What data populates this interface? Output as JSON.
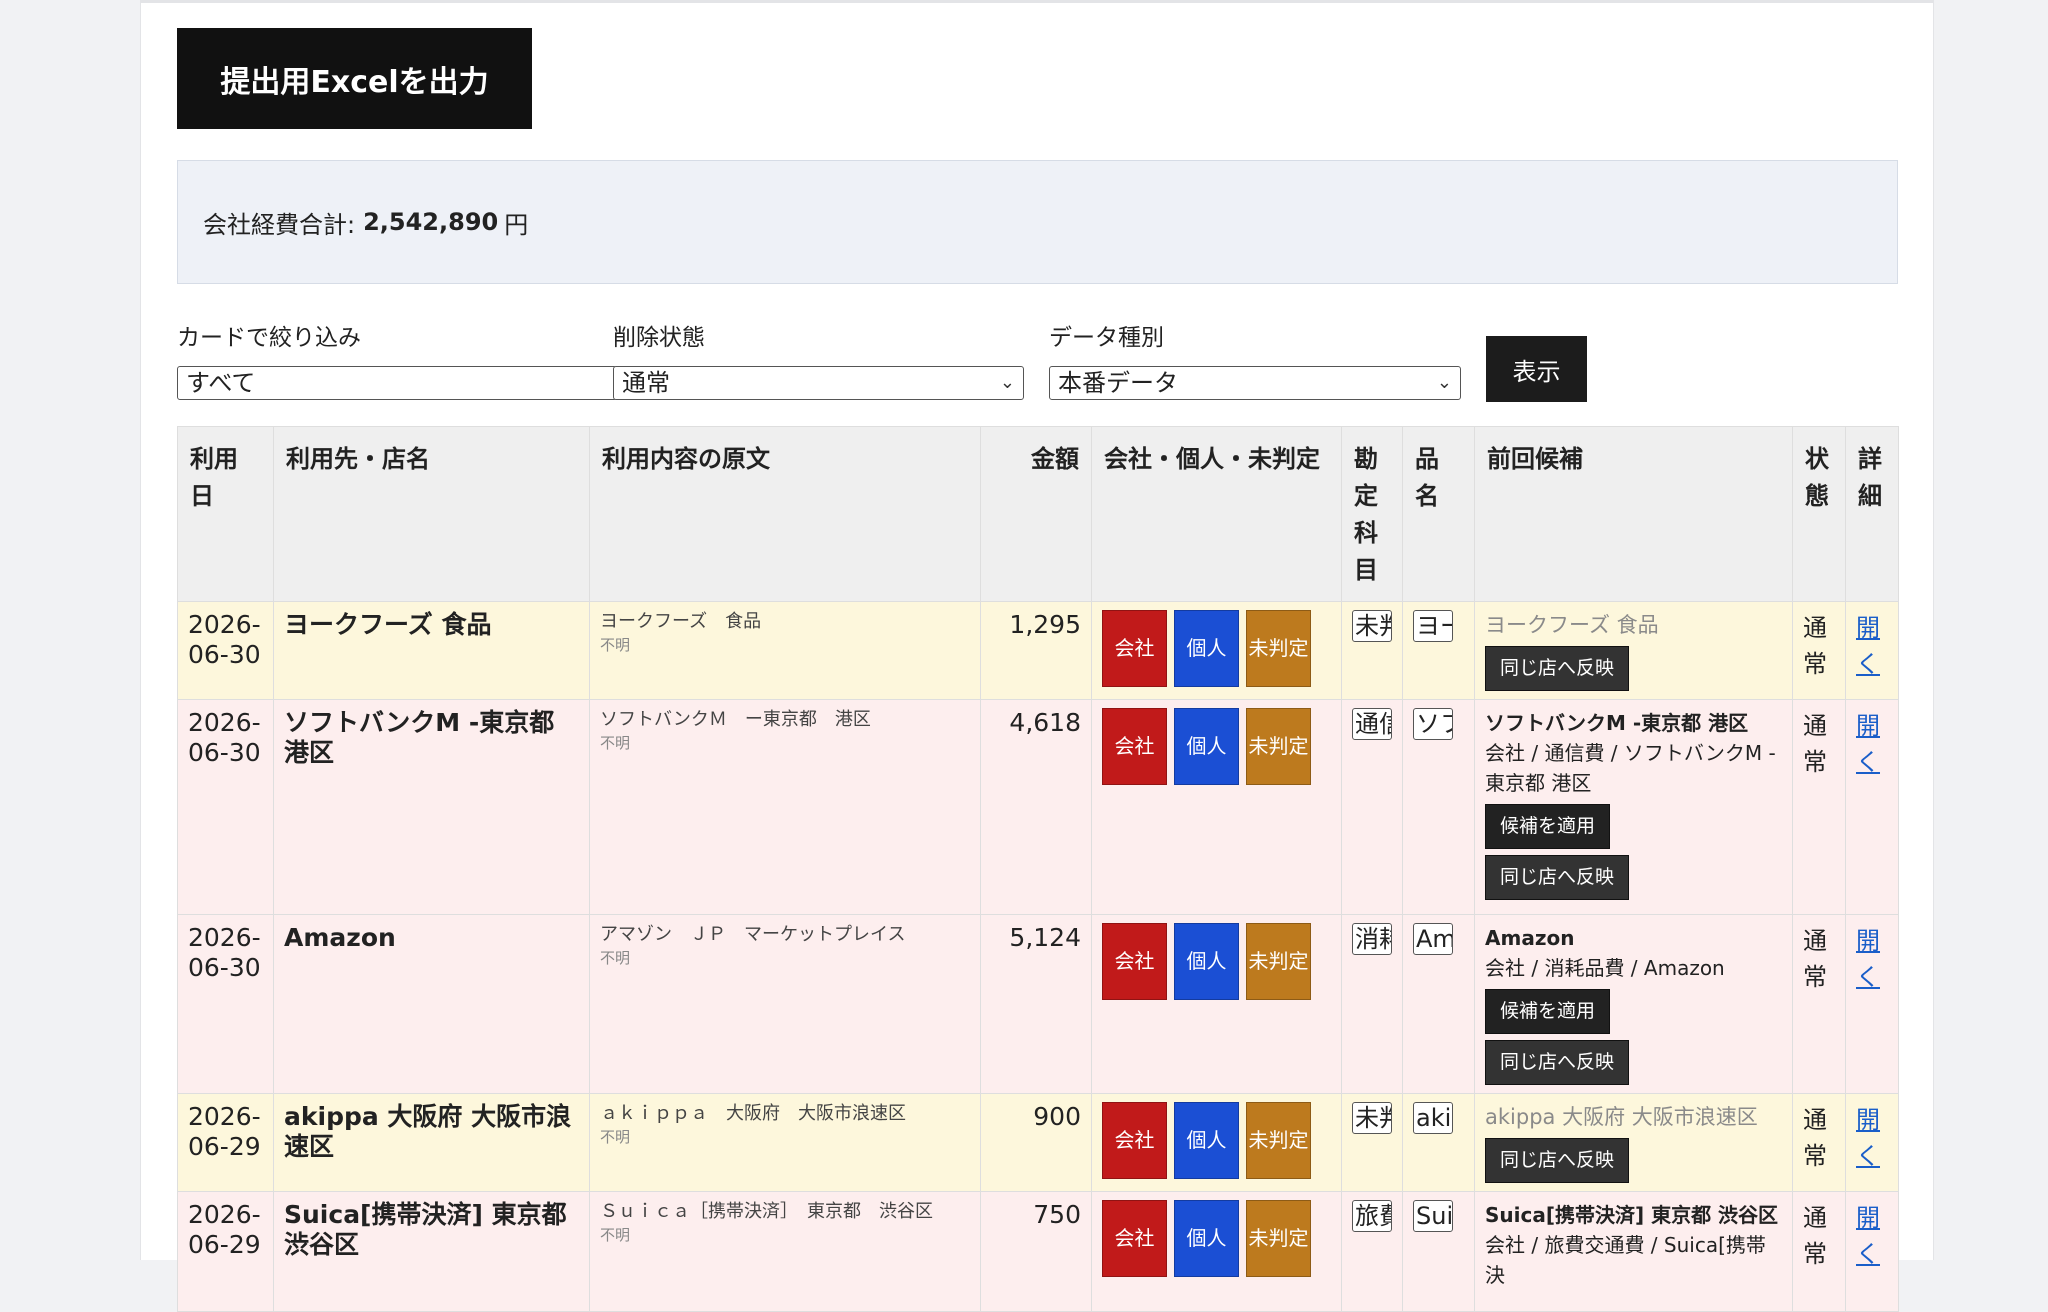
{
  "toolbar": {
    "export_label": "提出用Excelを出力"
  },
  "summary": {
    "label": "会社経費合計:",
    "amount": "2,542,890",
    "unit": "円"
  },
  "filters": {
    "card": {
      "label": "カードで絞り込み",
      "value": "すべて"
    },
    "deleted": {
      "label": "削除状態",
      "value": "通常"
    },
    "datatype": {
      "label": "データ種別",
      "value": "本番データ"
    },
    "show_label": "表示"
  },
  "table": {
    "headers": {
      "date": "利用日",
      "merchant": "利用先・店名",
      "raw": "利用内容の原文",
      "amount": "金額",
      "classify": "会社・個人・未判定",
      "account": "勘定科目",
      "item": "品名",
      "candidate": "前回候補",
      "status": "状態",
      "detail": "詳細"
    },
    "buttons": {
      "company": "会社",
      "personal": "個人",
      "undecided": "未判定"
    },
    "rows": [
      {
        "date": "2026-06-30",
        "merchant": "ヨークフーズ 食品",
        "raw": "ヨークフーズ　食品",
        "raw_sub": "不明",
        "amount": "1,295",
        "account": "未判定",
        "item": "ヨークフーズ",
        "candidate_text": "ヨークフーズ 食品",
        "cand_btn2": "同じ店へ反映",
        "status": "通常",
        "detail": "開く"
      },
      {
        "date": "2026-06-30",
        "merchant": "ソフトバンクM -東京都 港区",
        "raw": "ソフトバンクＭ　ー東京都　港区",
        "raw_sub": "不明",
        "amount": "4,618",
        "account": "通信費",
        "item": "ソフトバンク",
        "candidate_title": "ソフトバンクM -東京都 港区",
        "candidate_detail": "会社 / 通信費 / ソフトバンクM -東京都 港区",
        "cand_btn1": "候補を適用",
        "cand_btn2": "同じ店へ反映",
        "status": "通常",
        "detail": "開く"
      },
      {
        "date": "2026-06-30",
        "merchant": "Amazon",
        "raw": "アマゾン　ＪＰ　マーケットプレイス",
        "raw_sub": "不明",
        "amount": "5,124",
        "account": "消耗品費",
        "item": "Amazon",
        "candidate_title": "Amazon",
        "candidate_detail": "会社 / 消耗品費 / Amazon",
        "cand_btn1": "候補を適用",
        "cand_btn2": "同じ店へ反映",
        "status": "通常",
        "detail": "開く"
      },
      {
        "date": "2026-06-29",
        "merchant": "akippa 大阪府 大阪市浪速区",
        "raw": "ａｋｉｐｐａ　大阪府　大阪市浪速区",
        "raw_sub": "不明",
        "amount": "900",
        "account": "未判定",
        "item": "akippa",
        "candidate_text": "akippa 大阪府 大阪市浪速区",
        "cand_btn2": "同じ店へ反映",
        "status": "通常",
        "detail": "開く"
      },
      {
        "date": "2026-06-29",
        "merchant": "Suica[携帯決済] 東京都 渋谷区",
        "raw": "Ｓｕｉｃａ［携帯決済］　東京都　渋谷区",
        "raw_sub": "不明",
        "amount": "750",
        "account": "旅費交通費",
        "item": "Suica",
        "candidate_title": "Suica[携帯決済] 東京都 渋谷区",
        "candidate_detail": "会社 / 旅費交通費 / Suica[携帯決",
        "status": "通常",
        "detail": "開く"
      }
    ]
  }
}
